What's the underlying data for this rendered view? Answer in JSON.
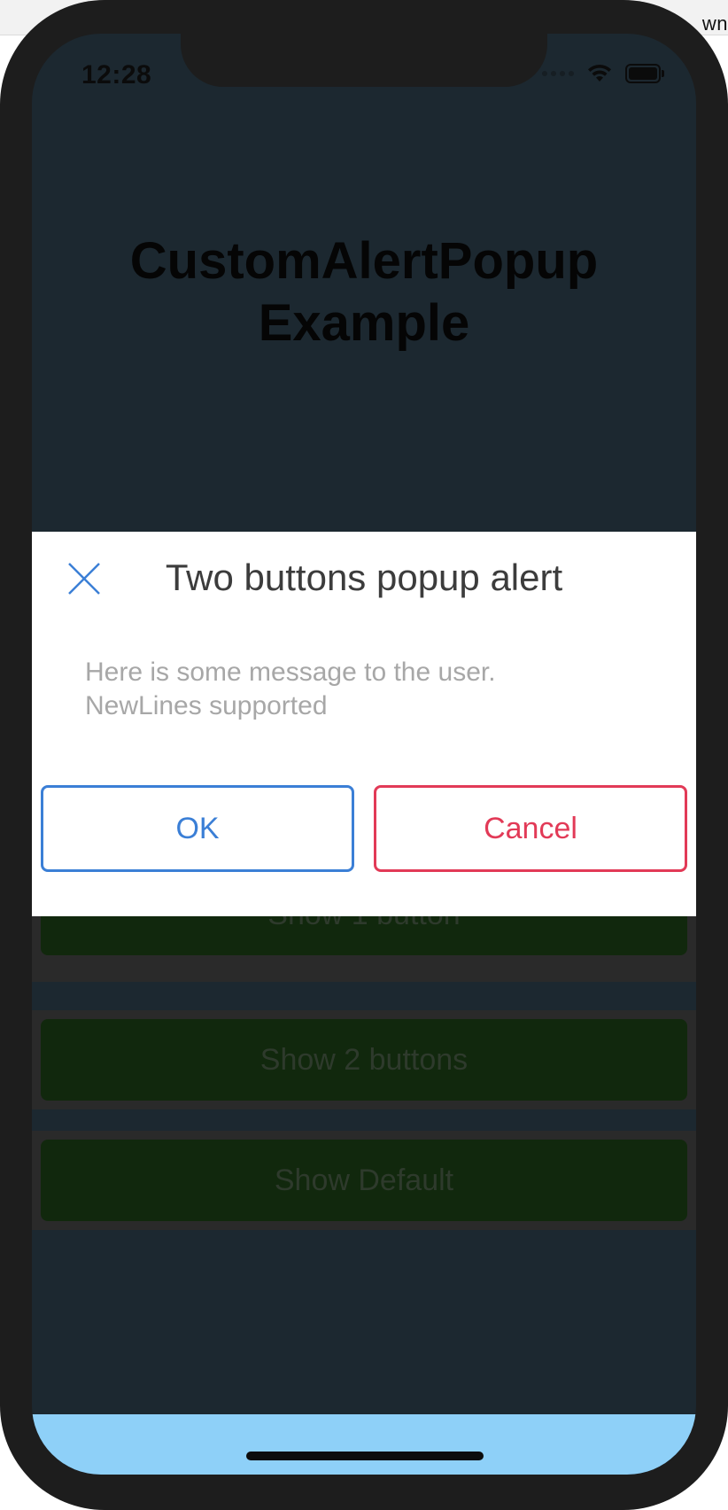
{
  "background": {
    "corner_text": "wn"
  },
  "status_bar": {
    "time": "12:28"
  },
  "app": {
    "title_line1": "CustomAlertPopup",
    "title_line2": "Example"
  },
  "list_buttons": [
    {
      "label": "Show 1 button"
    },
    {
      "label": "Show 2 buttons"
    },
    {
      "label": "Show Default"
    }
  ],
  "popup": {
    "title": "Two buttons popup alert",
    "message_line1": "Here is some message to the user.",
    "message_line2": "NewLines supported",
    "ok_label": "OK",
    "cancel_label": "Cancel",
    "close_icon": "close-icon"
  },
  "colors": {
    "accent_blue": "#3b7fd6",
    "accent_red": "#e23a57",
    "home_area": "#8ed0f8",
    "list_button": "#11280d"
  }
}
